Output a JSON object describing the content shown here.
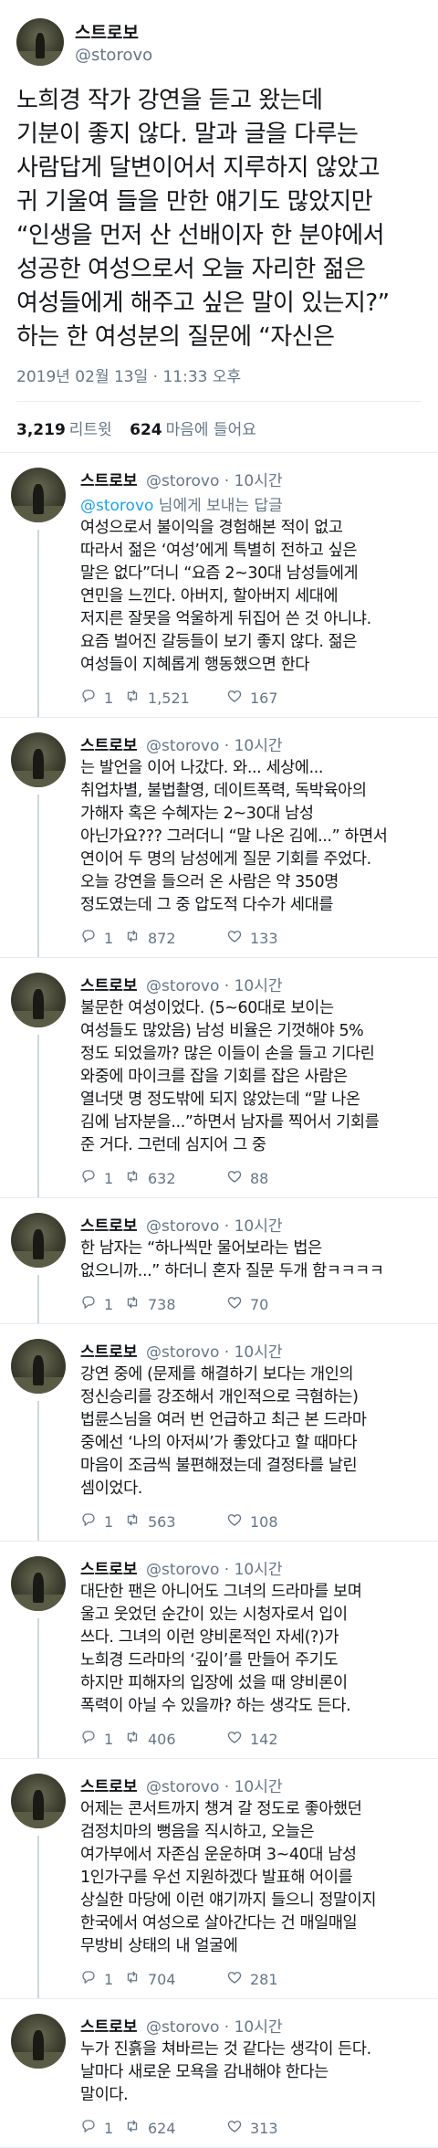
{
  "main": {
    "display_name": "스트로보",
    "handle": "@storovo",
    "text": "노희경 작가 강연을 듣고 왔는데\n기분이 좋지 않다. 말과 글을 다루는\n사람답게 달변이어서 지루하지 않았고\n귀 기울여 들을 만한 얘기도 많았지만\n“인생을 먼저 산 선배이자 한 분야에서\n성공한 여성으로서 오늘 자리한 젊은\n여성들에게 해주고 싶은 말이 있는지?”\n하는 한 여성분의 질문에 “자신은",
    "timestamp": "2019년 02월 13일 · 11:33 오후",
    "retweets": "3,219",
    "retweets_label": "리트윗",
    "likes": "624",
    "likes_label": "마음에 들어요"
  },
  "replies": [
    {
      "name": "스트로보",
      "meta": "@storovo · 10시간",
      "reply_mention": "@storovo",
      "reply_suffix": " 님에게 보내는 답글",
      "text": "여성으로서 불이익을 경험해본 적이 없고\n따라서 젊은 ‘여성’에게 특별히 전하고 싶은\n말은 없다”더니 “요즘 2~30대 남성들에게\n연민을 느낀다. 아버지, 할아버지 세대에\n저지른 잘못을 억울하게 뒤집어 쓴 것 아니냐.\n요즘 벌어진 갈등들이 보기 좋지 않다. 젊은\n여성들이 지혜롭게 행동했으면 한다",
      "replies": "1",
      "retweets": "1,521",
      "likes": "167"
    },
    {
      "name": "스트로보",
      "meta": "@storovo · 10시간",
      "text": "는 발언을 이어 나갔다. 와... 세상에...\n취업차별, 불법촬영, 데이트폭력, 독박육아의\n가해자 혹은 수혜자는 2~30대 남성\n아닌가요??? 그러더니 “말 나온 김에...” 하면서\n연이어 두 명의 남성에게 질문 기회를 주었다.\n오늘 강연을 들으러 온 사람은 약 350명\n정도였는데 그 중 압도적 다수가 세대를",
      "replies": "1",
      "retweets": "872",
      "likes": "133"
    },
    {
      "name": "스트로보",
      "meta": "@storovo · 10시간",
      "text": "불문한 여성이었다. (5~60대로 보이는\n여성들도 많았음) 남성 비율은 기껏해야 5%\n정도 되었을까? 많은 이들이 손을 들고 기다린\n와중에 마이크를 잡을 기회를 잡은 사람은\n열너댓 명 정도밖에 되지 않았는데 “말 나온\n김에 남자분을...”하면서 남자를 찍어서 기회를\n준 거다. 그런데 심지어 그 중",
      "replies": "1",
      "retweets": "632",
      "likes": "88"
    },
    {
      "name": "스트로보",
      "meta": "@storovo · 10시간",
      "text": "한 남자는 “하나씩만 물어보라는 법은\n없으니까...” 하더니 혼자 질문 두개 함ㅋㅋㅋㅋ",
      "replies": "1",
      "retweets": "738",
      "likes": "70"
    },
    {
      "name": "스트로보",
      "meta": "@storovo · 10시간",
      "text": "강연 중에 (문제를 해결하기 보다는 개인의\n정신승리를 강조해서 개인적으로 극혐하는)\n법륜스님을 여러 번 언급하고 최근 본 드라마\n중에선 ‘나의 아저씨’가 좋았다고 할 때마다\n마음이 조금씩 불편해졌는데 결정타를 날린\n셈이었다.",
      "replies": "1",
      "retweets": "563",
      "likes": "108"
    },
    {
      "name": "스트로보",
      "meta": "@storovo · 10시간",
      "text": "대단한 팬은 아니어도 그녀의 드라마를 보며\n울고 웃었던 순간이 있는 시청자로서 입이\n쓰다. 그녀의 이런 양비론적인 자세(?)가\n노희경 드라마의 ‘깊이’를 만들어 주기도\n하지만 피해자의 입장에 섰을 때 양비론이\n폭력이 아닐 수 있을까? 하는 생각도 든다.",
      "replies": "1",
      "retweets": "406",
      "likes": "142"
    },
    {
      "name": "스트로보",
      "meta": "@storovo · 10시간",
      "text": "어제는 콘서트까지 챙겨 갈 정도로 좋아했던\n검정치마의 뻥음을 직시하고, 오늘은\n여가부에서 자존심 운운하며 3~40대 남성\n1인가구를 우선 지원하겠다 발표해 어이를\n상실한 마당에 이런 얘기까지 들으니 정말이지\n한국에서 여성으로 살아간다는 건 매일매일\n무방비 상태의 내 얼굴에",
      "replies": "1",
      "retweets": "704",
      "likes": "281"
    },
    {
      "name": "스트로보",
      "meta": "@storovo · 10시간",
      "text": "누가 진흙을 쳐바르는 것 같다는 생각이 든다.\n날마다 새로운 모욕을 감내해야 한다는\n말이다.",
      "replies": "1",
      "retweets": "624",
      "likes": "313"
    }
  ],
  "icons": {
    "reply": "reply-icon",
    "retweet": "retweet-icon",
    "like": "heart-icon"
  },
  "colors": {
    "text": "#14171a",
    "muted": "#657786",
    "link": "#1da1f2",
    "divider": "#e6ecf0"
  }
}
